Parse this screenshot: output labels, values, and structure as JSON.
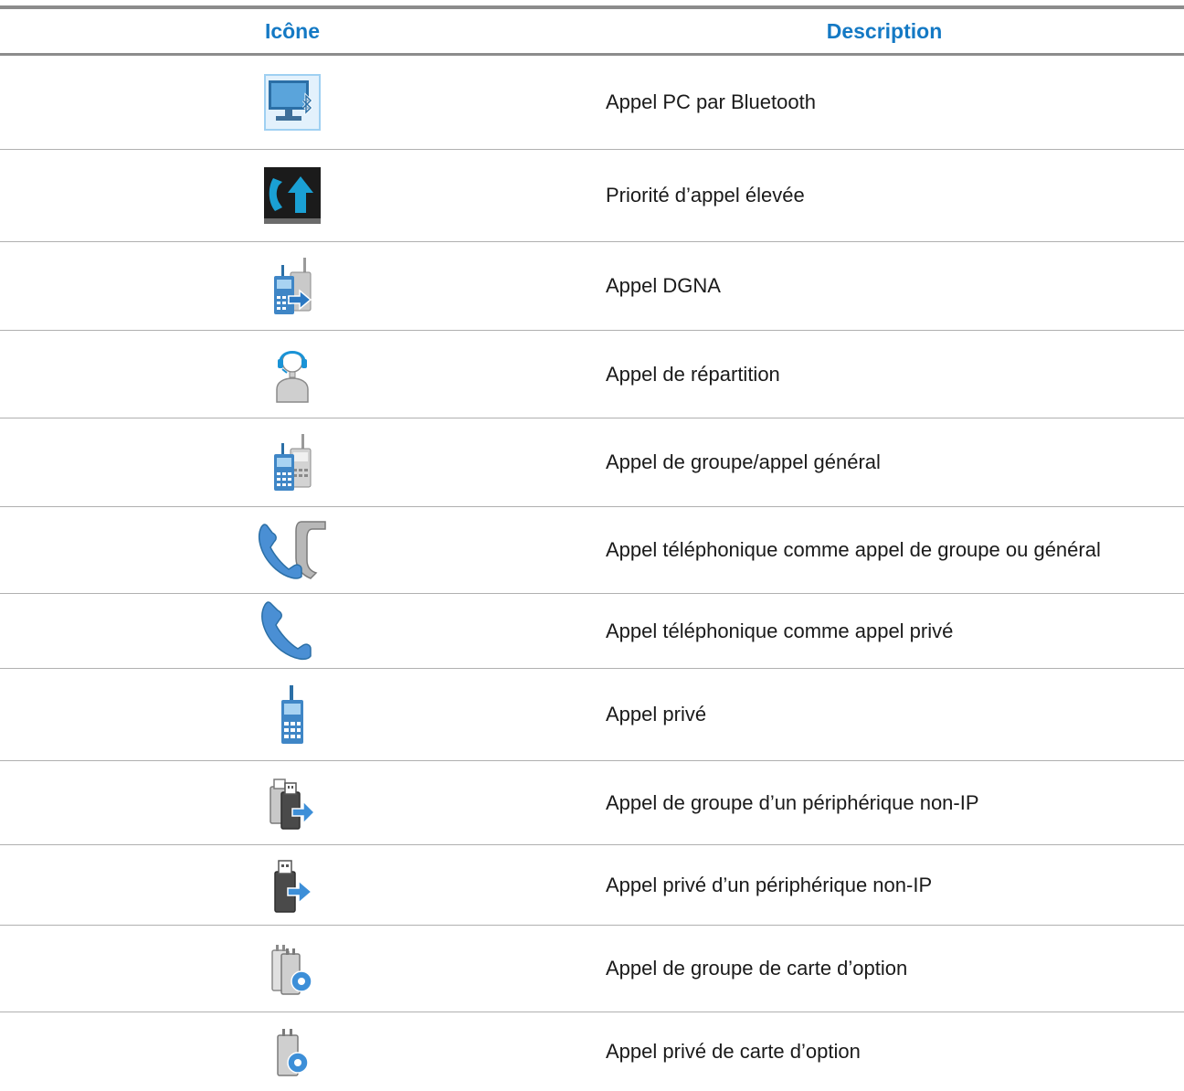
{
  "header": {
    "icon_col": "Icône",
    "desc_col": "Description"
  },
  "rows": [
    {
      "icon": "bluetooth-pc-icon",
      "desc": "Appel PC par Bluetooth"
    },
    {
      "icon": "high-priority-call-icon",
      "desc": "Priorité d’appel élevée"
    },
    {
      "icon": "dgna-call-icon",
      "desc": "Appel DGNA"
    },
    {
      "icon": "dispatch-call-icon",
      "desc": "Appel de répartition"
    },
    {
      "icon": "group-call-icon",
      "desc": "Appel de groupe/appel général"
    },
    {
      "icon": "phone-group-call-icon",
      "desc": "Appel téléphonique comme appel de groupe ou général"
    },
    {
      "icon": "phone-private-call-icon",
      "desc": "Appel téléphonique comme appel privé"
    },
    {
      "icon": "private-call-icon",
      "desc": "Appel privé"
    },
    {
      "icon": "non-ip-group-call-icon",
      "desc": "Appel de groupe d’un périphérique non-IP"
    },
    {
      "icon": "non-ip-private-call-icon",
      "desc": "Appel privé d’un périphérique non-IP"
    },
    {
      "icon": "option-board-group-call-icon",
      "desc": "Appel de groupe de carte d’option"
    },
    {
      "icon": "option-board-private-call-icon",
      "desc": "Appel privé de carte d’option"
    }
  ]
}
